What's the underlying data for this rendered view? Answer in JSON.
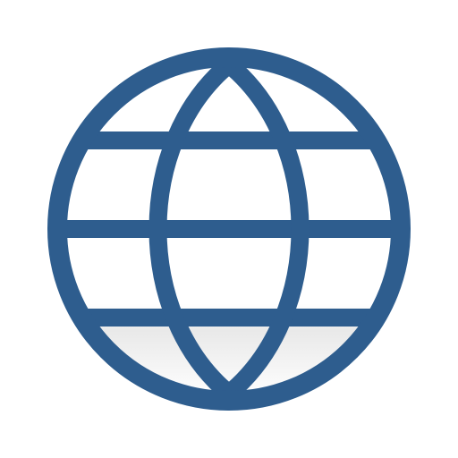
{
  "icon": {
    "name": "globe-icon",
    "stroke_color": "#2e5d8e",
    "fill_color": "#ffffff",
    "shadow_color": "#e6e6e6"
  }
}
